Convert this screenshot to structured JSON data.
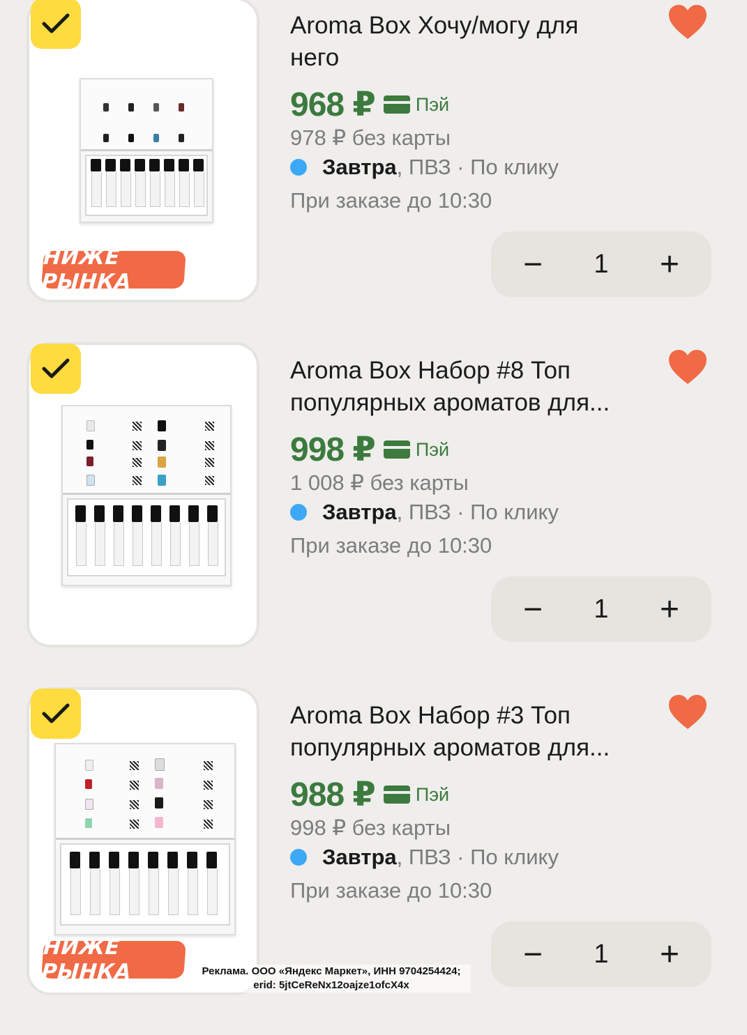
{
  "items": [
    {
      "title_line1": "Aroma Box Хочу/могу для",
      "title_line2": "него",
      "price": "968 ₽",
      "pay_label": "Пэй",
      "old_price": "978 ₽ без карты",
      "delivery_day": "Завтра",
      "delivery_rest": ", ПВЗ · По клику",
      "order_until": "При заказе до 10:30",
      "quantity": "1",
      "badge": "НИЖЕ РЫНКА"
    },
    {
      "title_line1": "Aroma Box Набор #8 Топ",
      "title_line2": "популярных ароматов для...",
      "price": "998 ₽",
      "pay_label": "Пэй",
      "old_price": "1 008 ₽ без карты",
      "delivery_day": "Завтра",
      "delivery_rest": ", ПВЗ · По клику",
      "order_until": "При заказе до 10:30",
      "quantity": "1"
    },
    {
      "title_line1": "Aroma Box Набор #3 Топ",
      "title_line2": "популярных ароматов для...",
      "price": "988 ₽",
      "pay_label": "Пэй",
      "old_price": "998 ₽ без карты",
      "delivery_day": "Завтра",
      "delivery_rest": ", ПВЗ · По клику",
      "order_until": "При заказе до 10:30",
      "quantity": "1",
      "badge": "НИЖЕ РЫНКА"
    }
  ],
  "stepper": {
    "minus": "−",
    "plus": "+"
  },
  "ad": {
    "line1": "Реклама. ООО «Яндекс Маркет», ИНН 9704254424;",
    "line2": "erid: 5jtCeReNx12oajze1ofcX4x"
  },
  "colors": {
    "price_green": "#3c7a3e",
    "heart": "#f06a45",
    "checkbox": "#fedb3f",
    "badge": "#f06a45",
    "delivery_dot": "#3da8f5"
  },
  "icons": {
    "checkbox": "check-icon",
    "favorite": "heart-icon",
    "payment": "card-icon"
  }
}
